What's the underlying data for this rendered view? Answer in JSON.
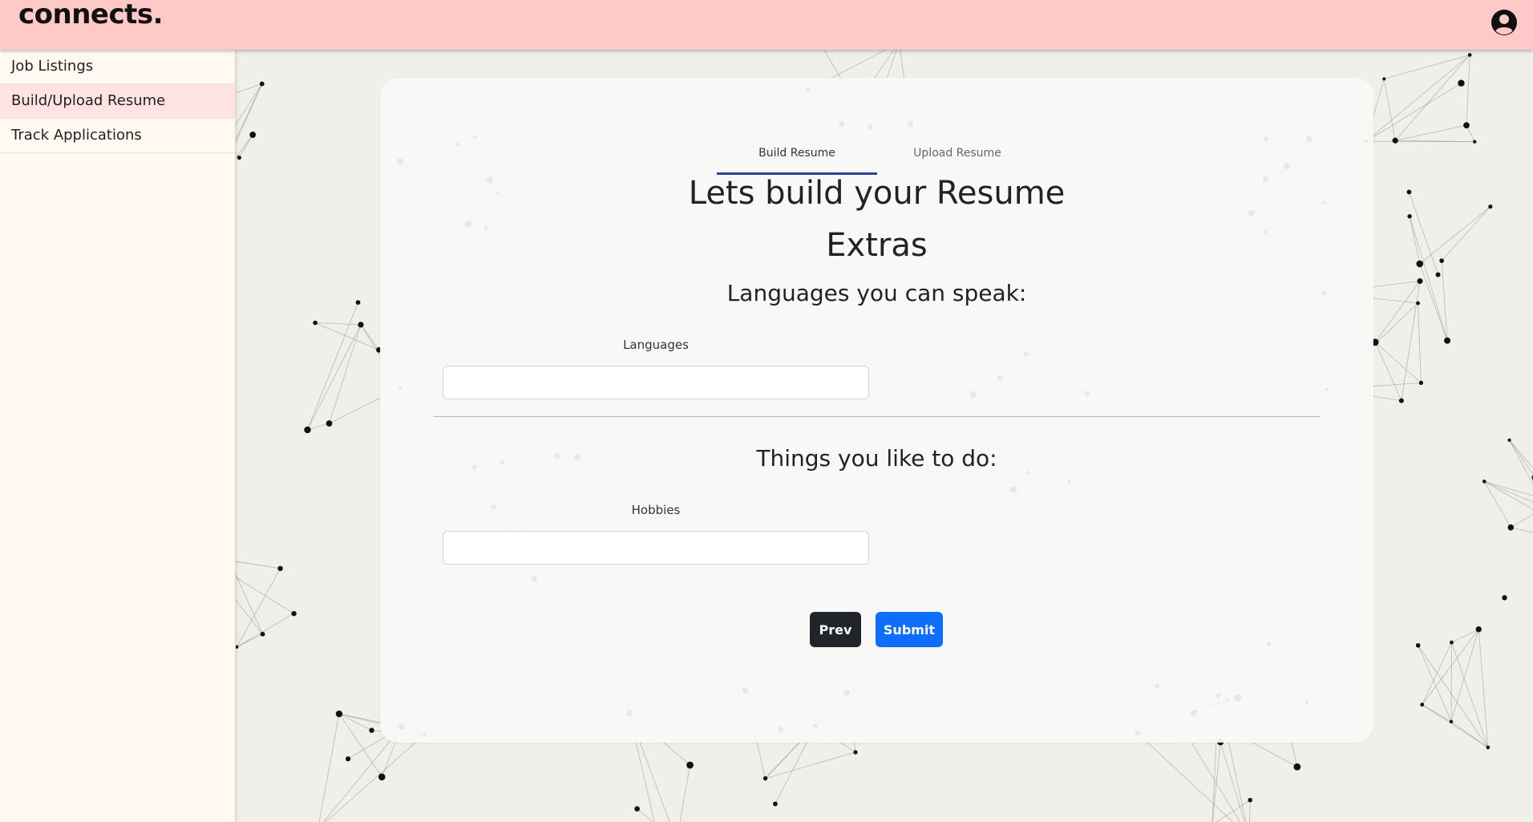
{
  "header": {
    "brand": "connects.",
    "account_icon": "account-circle-icon",
    "background_color": "#ffc9c8"
  },
  "sidebar": {
    "items": [
      {
        "label": "Job Listings",
        "active": false
      },
      {
        "label": "Build/Upload Resume",
        "active": true
      },
      {
        "label": "Track Applications",
        "active": false
      }
    ]
  },
  "main": {
    "tabs": [
      {
        "label": "Build Resume",
        "active": true
      },
      {
        "label": "Upload Resume",
        "active": false
      }
    ],
    "heading": "Lets build your Resume",
    "section_title": "Extras",
    "languages": {
      "subtitle": "Languages you can speak:",
      "label": "Languages",
      "value": ""
    },
    "hobbies": {
      "subtitle": "Things you like to do:",
      "label": "Hobbies",
      "value": ""
    },
    "buttons": {
      "prev": "Prev",
      "submit": "Submit"
    },
    "colors": {
      "accent": "#0d6efd",
      "tab_underline": "#2e3f9e",
      "prev_button": "#212529"
    }
  }
}
